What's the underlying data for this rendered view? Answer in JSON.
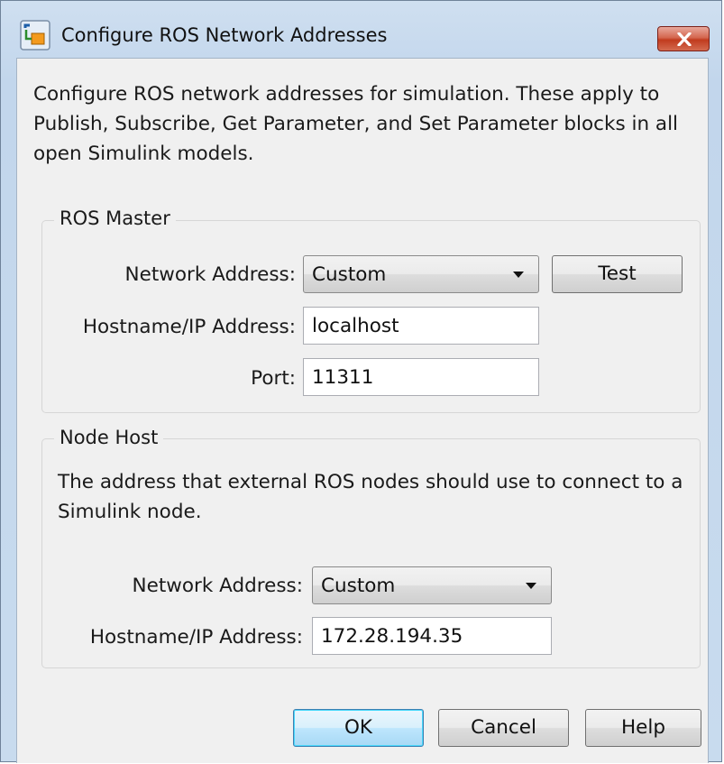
{
  "window": {
    "title": "Configure ROS Network Addresses"
  },
  "description": "Configure ROS network addresses for simulation. These apply to Publish, Subscribe, Get Parameter, and Set Parameter blocks in all open Simulink models.",
  "ros_master": {
    "group_label": "ROS Master",
    "network_address_label": "Network Address:",
    "network_address_value": "Custom",
    "test_button": "Test",
    "hostname_label": "Hostname/IP Address:",
    "hostname_value": "localhost",
    "port_label": "Port:",
    "port_value": "11311"
  },
  "node_host": {
    "group_label": "Node Host",
    "description": "The address that external ROS nodes should use to connect to a Simulink node.",
    "network_address_label": "Network Address:",
    "network_address_value": "Custom",
    "hostname_label": "Hostname/IP Address:",
    "hostname_value": "172.28.194.35"
  },
  "buttons": {
    "ok": "OK",
    "cancel": "Cancel",
    "help": "Help"
  },
  "colors": {
    "close_button": "#c13b1e",
    "default_button_border": "#3c7fb1",
    "dialog_background": "#f0f0f0"
  }
}
